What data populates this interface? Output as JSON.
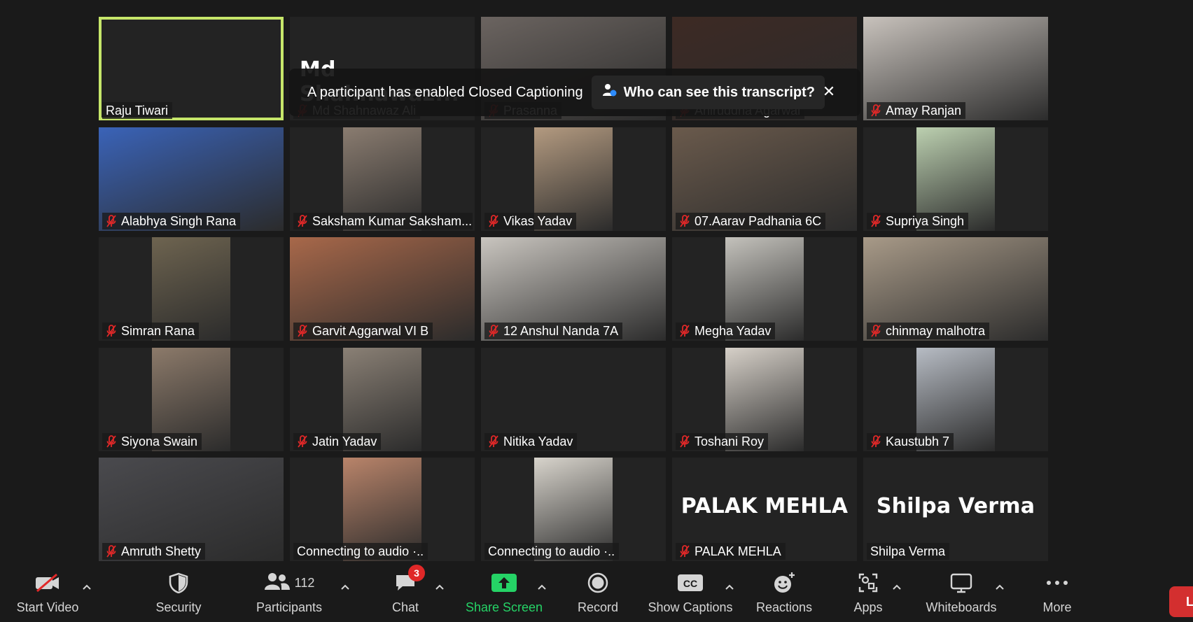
{
  "banner": {
    "message": "A participant has enabled Closed Captioning",
    "who_label": "Who can see this transcript?",
    "close_symbol": "✕"
  },
  "tiles": [
    {
      "name": "Raju Tiwari",
      "muted": false,
      "active": true
    },
    {
      "name": "Md Shahnawaz Ali",
      "muted": true,
      "big_name": "Md  Shahnawaz..."
    },
    {
      "name": "Prasanna",
      "muted": true,
      "video_color": "#6b6460"
    },
    {
      "name": "Aniruddha Agarwal",
      "muted": true,
      "video_color": "#3d2a24"
    },
    {
      "name": "Amay Ranjan",
      "muted": true,
      "video_color": "#c8c2bc"
    },
    {
      "name": "Alabhya Singh Rana",
      "muted": true,
      "video_color": "#3a63b8"
    },
    {
      "name": "Saksham Kumar Saksham...",
      "muted": true,
      "video_color": "#8a7c70"
    },
    {
      "name": "Vikas Yadav",
      "muted": true,
      "video_color": "#b39a80"
    },
    {
      "name": "07.Aarav Padhania 6C",
      "muted": true,
      "video_color": "#6a5a4c"
    },
    {
      "name": "Supriya Singh",
      "muted": true,
      "video_color": "#bcd0b0"
    },
    {
      "name": "Simran Rana",
      "muted": true,
      "video_color": "#6e6450"
    },
    {
      "name": "Garvit Aggarwal VI B",
      "muted": true,
      "video_color": "#a8684a"
    },
    {
      "name": "12 Anshul Nanda 7A",
      "muted": true,
      "video_color": "#c9c5bf"
    },
    {
      "name": "Megha Yadav",
      "muted": true,
      "video_color": "#c4c2bc"
    },
    {
      "name": "chinmay malhotra",
      "muted": true,
      "video_color": "#a89a88"
    },
    {
      "name": "Siyona Swain",
      "muted": true,
      "video_color": "#8c7a6a"
    },
    {
      "name": "Jatin Yadav",
      "muted": true,
      "video_color": "#8a8075"
    },
    {
      "name": "Nitika Yadav",
      "muted": true
    },
    {
      "name": "Toshani Roy",
      "muted": true,
      "video_color": "#d6d0c8"
    },
    {
      "name": "Kaustubh 7",
      "muted": true,
      "video_color": "#b7bcc4"
    },
    {
      "name": "Amruth Shetty",
      "muted": true,
      "video_color": "#4a4a4e"
    },
    {
      "name": "Connecting to audio ·..",
      "muted": false,
      "video_color": "#b9846a"
    },
    {
      "name": "Connecting to audio ·..",
      "muted": false,
      "video_color": "#d8d4cc"
    },
    {
      "name": "PALAK MEHLA",
      "muted": true,
      "big_name": "PALAK MEHLA"
    },
    {
      "name": "Shilpa Verma",
      "muted": false,
      "big_name": "Shilpa Verma"
    }
  ],
  "toolbar": {
    "start_video": "Start Video",
    "security": "Security",
    "participants": "Participants",
    "participants_count": "112",
    "chat": "Chat",
    "chat_badge": "3",
    "share_screen": "Share Screen",
    "record": "Record",
    "show_captions": "Show Captions",
    "reactions": "Reactions",
    "apps": "Apps",
    "whiteboards": "Whiteboards",
    "more": "More",
    "leave_partial": "Le"
  },
  "colors": {
    "active_speaker_border": "#c6e66a",
    "share_green": "#25d366",
    "muted_red": "#e02828",
    "leave_red": "#d32f2f"
  }
}
